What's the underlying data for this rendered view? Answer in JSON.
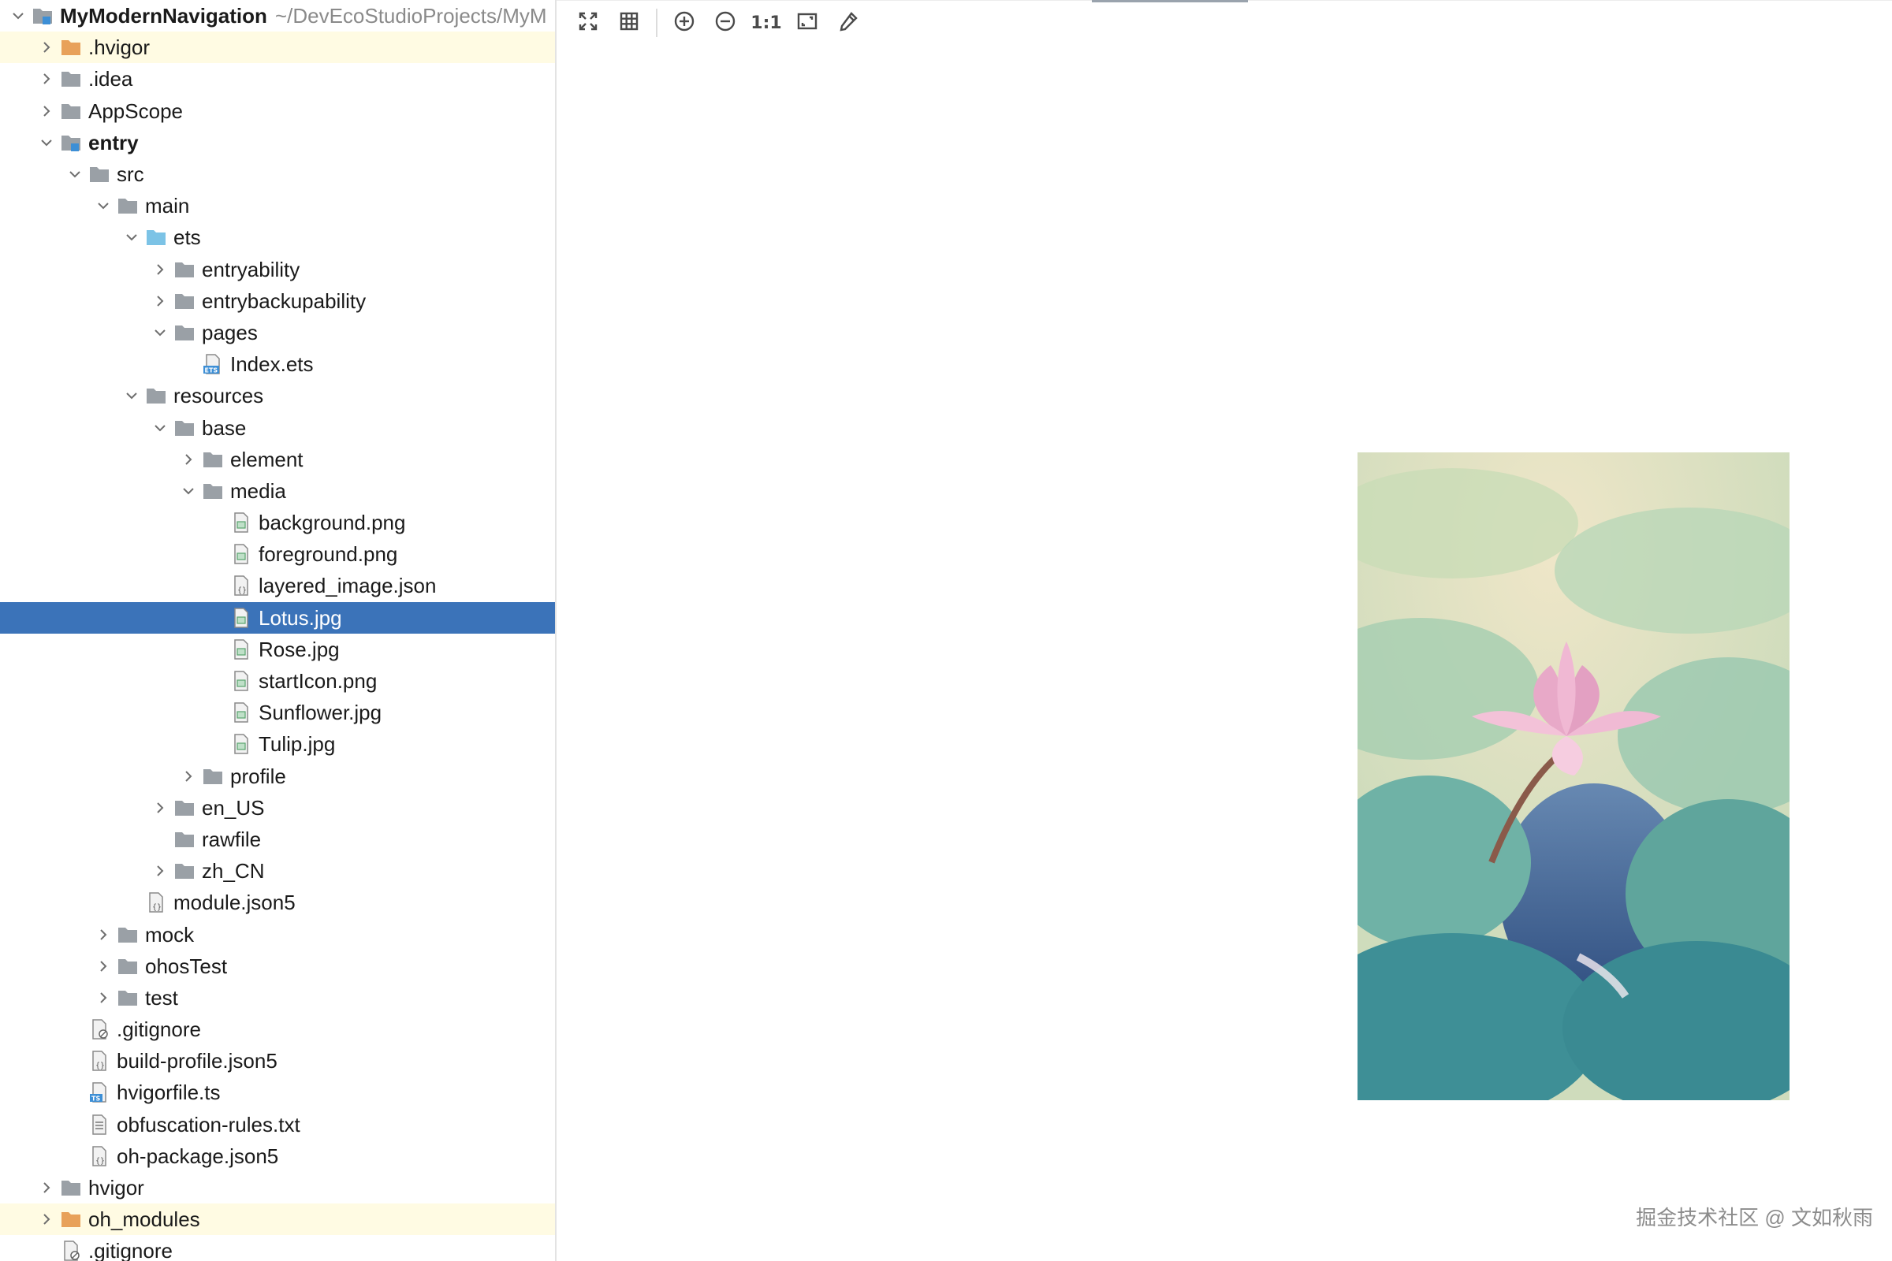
{
  "tree": {
    "rows": [
      {
        "label": "MyModernNavigation",
        "path": "~/DevEcoStudioProjects/MyM",
        "depth": 0,
        "expand": "open",
        "icon": "module-folder-icon",
        "bold": true
      },
      {
        "label": ".hvigor",
        "depth": 1,
        "expand": "closed",
        "icon": "folder-orange-icon",
        "hl": true
      },
      {
        "label": ".idea",
        "depth": 1,
        "expand": "closed",
        "icon": "folder-icon"
      },
      {
        "label": "AppScope",
        "depth": 1,
        "expand": "closed",
        "icon": "folder-icon"
      },
      {
        "label": "entry",
        "depth": 1,
        "expand": "open",
        "icon": "module-folder-icon",
        "bold": true
      },
      {
        "label": "src",
        "depth": 2,
        "expand": "open",
        "icon": "folder-icon"
      },
      {
        "label": "main",
        "depth": 3,
        "expand": "open",
        "icon": "folder-icon"
      },
      {
        "label": "ets",
        "depth": 4,
        "expand": "open",
        "icon": "folder-blue-icon"
      },
      {
        "label": "entryability",
        "depth": 5,
        "expand": "closed",
        "icon": "folder-icon"
      },
      {
        "label": "entrybackupability",
        "depth": 5,
        "expand": "closed",
        "icon": "folder-icon"
      },
      {
        "label": "pages",
        "depth": 5,
        "expand": "open",
        "icon": "folder-icon"
      },
      {
        "label": "Index.ets",
        "depth": 6,
        "expand": "none",
        "icon": "ets-file-icon"
      },
      {
        "label": "resources",
        "depth": 4,
        "expand": "open",
        "icon": "folder-icon"
      },
      {
        "label": "base",
        "depth": 5,
        "expand": "open",
        "icon": "folder-icon"
      },
      {
        "label": "element",
        "depth": 6,
        "expand": "closed",
        "icon": "folder-icon"
      },
      {
        "label": "media",
        "depth": 6,
        "expand": "open",
        "icon": "folder-icon"
      },
      {
        "label": "background.png",
        "depth": 7,
        "expand": "none",
        "icon": "image-file-icon"
      },
      {
        "label": "foreground.png",
        "depth": 7,
        "expand": "none",
        "icon": "image-file-icon"
      },
      {
        "label": "layered_image.json",
        "depth": 7,
        "expand": "none",
        "icon": "json-file-icon"
      },
      {
        "label": "Lotus.jpg",
        "depth": 7,
        "expand": "none",
        "icon": "image-file-icon",
        "selected": true
      },
      {
        "label": "Rose.jpg",
        "depth": 7,
        "expand": "none",
        "icon": "image-file-icon"
      },
      {
        "label": "startIcon.png",
        "depth": 7,
        "expand": "none",
        "icon": "image-file-icon"
      },
      {
        "label": "Sunflower.jpg",
        "depth": 7,
        "expand": "none",
        "icon": "image-file-icon"
      },
      {
        "label": "Tulip.jpg",
        "depth": 7,
        "expand": "none",
        "icon": "image-file-icon"
      },
      {
        "label": "profile",
        "depth": 6,
        "expand": "closed",
        "icon": "folder-icon"
      },
      {
        "label": "en_US",
        "depth": 5,
        "expand": "closed",
        "icon": "folder-icon"
      },
      {
        "label": "rawfile",
        "depth": 5,
        "expand": "none",
        "icon": "folder-icon"
      },
      {
        "label": "zh_CN",
        "depth": 5,
        "expand": "closed",
        "icon": "folder-icon"
      },
      {
        "label": "module.json5",
        "depth": 4,
        "expand": "none",
        "icon": "json-file-icon"
      },
      {
        "label": "mock",
        "depth": 3,
        "expand": "closed",
        "icon": "folder-icon"
      },
      {
        "label": "ohosTest",
        "depth": 3,
        "expand": "closed",
        "icon": "folder-icon"
      },
      {
        "label": "test",
        "depth": 3,
        "expand": "closed",
        "icon": "folder-icon"
      },
      {
        "label": ".gitignore",
        "depth": 2,
        "expand": "none",
        "icon": "gitignore-file-icon"
      },
      {
        "label": "build-profile.json5",
        "depth": 2,
        "expand": "none",
        "icon": "json-file-icon"
      },
      {
        "label": "hvigorfile.ts",
        "depth": 2,
        "expand": "none",
        "icon": "ts-file-icon"
      },
      {
        "label": "obfuscation-rules.txt",
        "depth": 2,
        "expand": "none",
        "icon": "text-file-icon"
      },
      {
        "label": "oh-package.json5",
        "depth": 2,
        "expand": "none",
        "icon": "json-file-icon"
      },
      {
        "label": "hvigor",
        "depth": 1,
        "expand": "closed",
        "icon": "folder-icon"
      },
      {
        "label": "oh_modules",
        "depth": 1,
        "expand": "closed",
        "icon": "folder-orange-icon",
        "hl": true
      },
      {
        "label": ".gitignore",
        "depth": 1,
        "expand": "none",
        "icon": "gitignore-file-icon"
      }
    ]
  },
  "toolbar": {
    "buttons": [
      {
        "name": "fit-screen-icon"
      },
      {
        "name": "grid-icon"
      },
      {
        "name": "zoom-in-icon"
      },
      {
        "name": "zoom-out-icon"
      },
      {
        "name": "actual-size-icon",
        "text": "1:1"
      },
      {
        "name": "fit-window-icon"
      },
      {
        "name": "color-picker-icon"
      }
    ]
  },
  "viewer": {
    "image_subject": "Pink lotus flower among lily pads",
    "watermark": "掘金技术社区 @ 文如秋雨"
  },
  "colors": {
    "selection": "#3b73b9",
    "highlight_row": "#fffbe3",
    "folder_gray": "#9aa0a6",
    "folder_orange": "#e8a15a",
    "folder_blue": "#7cc3e6"
  }
}
